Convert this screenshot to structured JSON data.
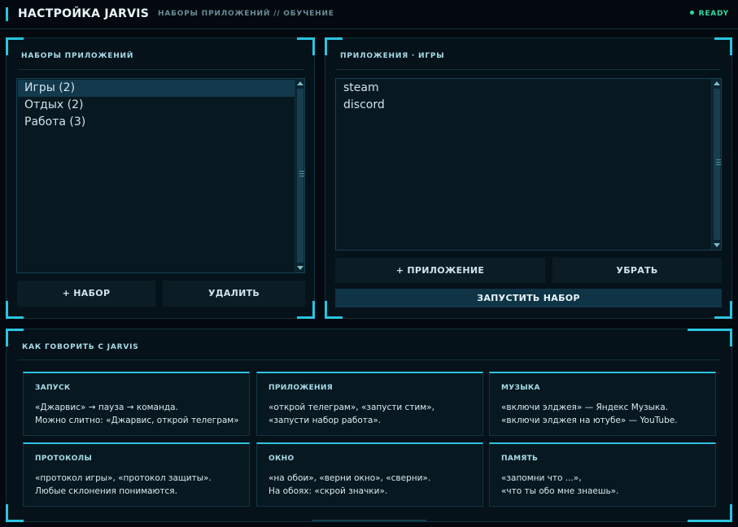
{
  "header": {
    "title": "НАСТРОЙКА JARVIS",
    "breadcrumb": "НАБОРЫ ПРИЛОЖЕНИЙ // ОБУЧЕНИЕ",
    "status": "READY"
  },
  "sets_panel": {
    "title": "НАБОРЫ ПРИЛОЖЕНИЙ",
    "items": [
      {
        "label": "Игры   (2)"
      },
      {
        "label": "Отдых   (2)"
      },
      {
        "label": "Работа   (3)"
      }
    ],
    "selected_index": 0,
    "add_button": "+ НАБОР",
    "delete_button": "УДАЛИТЬ"
  },
  "apps_panel": {
    "title": "ПРИЛОЖЕНИЯ · ИГРЫ",
    "items": [
      {
        "label": "steam"
      },
      {
        "label": "discord"
      }
    ],
    "add_button": "+ ПРИЛОЖЕНИЕ",
    "remove_button": "УБРАТЬ",
    "launch_button": "ЗАПУСТИТЬ НАБОР"
  },
  "guide": {
    "title": "КАК ГОВОРИТЬ С JARVIS",
    "cards": [
      {
        "title": "ЗАПУСК",
        "lines": [
          "«Джарвис» → пауза → команда.",
          "Можно слитно: «Джарвис, открой телеграм»"
        ]
      },
      {
        "title": "ПРИЛОЖЕНИЯ",
        "lines": [
          "«открой телеграм», «запусти стим»,",
          "«запусти набор работа»."
        ]
      },
      {
        "title": "МУЗЫКА",
        "lines": [
          "«включи элджея» — Яндекс Музыка.",
          "«включи элджея на ютубе» — YouTube."
        ]
      },
      {
        "title": "ПРОТОКОЛЫ",
        "lines": [
          "«протокол игры», «протокол защиты».",
          "Любые склонения понимаются."
        ]
      },
      {
        "title": "ОКНО",
        "lines": [
          "«на обои», «верни окно», «сверни».",
          "На обоях: «скрой значки»."
        ]
      },
      {
        "title": "ПАМЯТЬ",
        "lines": [
          "«запомни что ...»,",
          "«что ты обо мне знаешь»."
        ]
      }
    ]
  },
  "colors": {
    "accent": "#2bc4e0",
    "background": "#03090e",
    "panel": "#06121a",
    "status_ready": "#2fd9a0",
    "selection": "#123a4c"
  }
}
